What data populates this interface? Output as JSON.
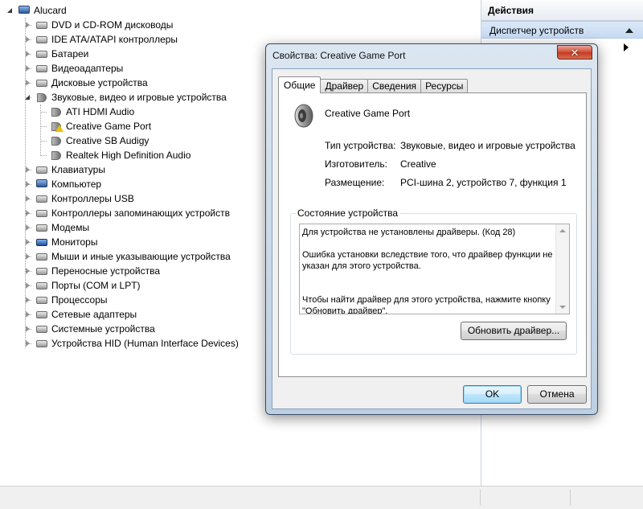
{
  "tree": {
    "root": "Alucard",
    "categories": [
      {
        "label": "DVD и CD-ROM дисководы",
        "icon": "dvd-drive-icon"
      },
      {
        "label": "IDE ATA/ATAPI контроллеры",
        "icon": "ide-controller-icon"
      },
      {
        "label": "Батареи",
        "icon": "battery-icon"
      },
      {
        "label": "Видеоадаптеры",
        "icon": "video-adapter-icon"
      },
      {
        "label": "Дисковые устройства",
        "icon": "disk-drive-icon"
      },
      {
        "label": "Звуковые, видео и игровые устройства",
        "icon": "speaker-icon",
        "children": [
          {
            "label": "ATI HDMI Audio",
            "warning": false
          },
          {
            "label": "Creative Game Port",
            "warning": true
          },
          {
            "label": "Creative SB Audigy",
            "warning": false
          },
          {
            "label": "Realtek High Definition Audio",
            "warning": false
          }
        ]
      },
      {
        "label": "Клавиатуры",
        "icon": "keyboard-icon"
      },
      {
        "label": "Компьютер",
        "icon": "computer-icon"
      },
      {
        "label": "Контроллеры USB",
        "icon": "usb-icon"
      },
      {
        "label": "Контроллеры запоминающих устройств",
        "icon": "storage-controller-icon"
      },
      {
        "label": "Модемы",
        "icon": "modem-icon"
      },
      {
        "label": "Мониторы",
        "icon": "monitor-icon"
      },
      {
        "label": "Мыши и иные указывающие устройства",
        "icon": "mouse-icon"
      },
      {
        "label": "Переносные устройства",
        "icon": "portable-device-icon"
      },
      {
        "label": "Порты (COM и LPT)",
        "icon": "port-icon"
      },
      {
        "label": "Процессоры",
        "icon": "processor-icon"
      },
      {
        "label": "Сетевые адаптеры",
        "icon": "network-adapter-icon"
      },
      {
        "label": "Системные устройства",
        "icon": "system-device-icon"
      },
      {
        "label": "Устройства HID (Human Interface Devices)",
        "icon": "hid-icon"
      }
    ]
  },
  "actions": {
    "header": "Действия",
    "items": [
      "Диспетчер устройств"
    ]
  },
  "dialog": {
    "title": "Свойства: Creative Game Port",
    "close_glyph": "✕",
    "tabs": [
      "Общие",
      "Драйвер",
      "Сведения",
      "Ресурсы"
    ],
    "active_tab": 0,
    "device_name": "Creative Game Port",
    "props": [
      {
        "label": "Тип устройства:",
        "value": "Звуковые, видео и игровые устройства"
      },
      {
        "label": "Изготовитель:",
        "value": "Creative"
      },
      {
        "label": "Размещение:",
        "value": "PCI-шина 2, устройство 7, функция 1"
      }
    ],
    "status_group_label": "Состояние устройства",
    "status_text": "Для устройства не установлены драйверы. (Код 28)\n\nОшибка установки вследствие того, что драйвер функции не указан для этого устройства.\n\n\nЧтобы найти драйвер для этого устройства, нажмите кнопку \"Обновить драйвер\".",
    "update_button": "Обновить драйвер...",
    "ok_button": "OK",
    "cancel_button": "Отмена"
  }
}
